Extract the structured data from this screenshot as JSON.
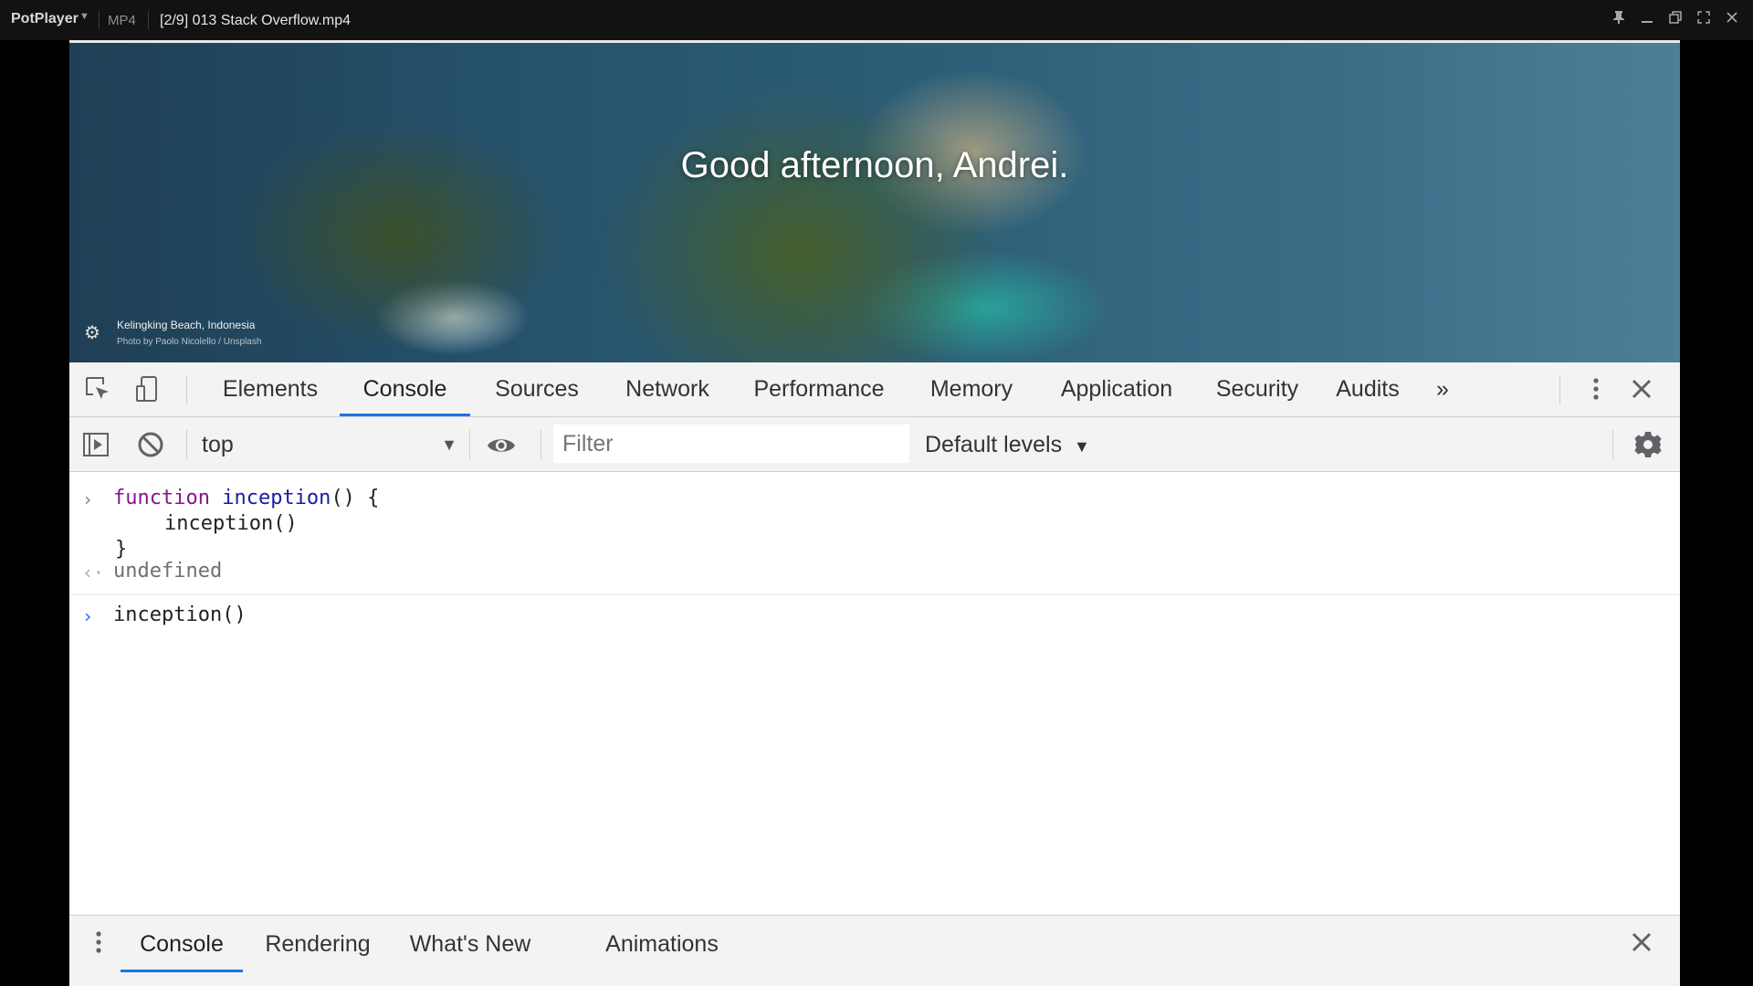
{
  "player": {
    "app_name": "PotPlayer",
    "format": "MP4",
    "file_title": "[2/9] 013 Stack Overflow.mp4",
    "icons": [
      "chevron-down-icon",
      "pin-icon",
      "minimize-icon",
      "restore-icon",
      "fullscreen-icon",
      "close-icon"
    ]
  },
  "hero": {
    "greeting": "Good afternoon, Andrei.",
    "location": "Kelingking Beach, Indonesia",
    "credit": "Photo by Paolo Nicolello / Unsplash"
  },
  "devtools": {
    "tabs": [
      {
        "label": "Elements"
      },
      {
        "label": "Console"
      },
      {
        "label": "Sources"
      },
      {
        "label": "Network"
      },
      {
        "label": "Performance"
      },
      {
        "label": "Memory"
      },
      {
        "label": "Application"
      },
      {
        "label": "Security"
      },
      {
        "label": "Audits"
      }
    ],
    "active_tab": "Console",
    "more_tabs_glyph": "»",
    "console_toolbar": {
      "context": "top",
      "filter_placeholder": "Filter",
      "levels_label": "Default levels",
      "levels_arrow": "▼"
    },
    "console": {
      "input1": {
        "keyword": "function",
        "name": "inception",
        "rest": "() {",
        "body": "inception()",
        "close": "}"
      },
      "result1": "undefined",
      "input2": "inception()"
    },
    "drawer": {
      "tabs": [
        {
          "label": "Console"
        },
        {
          "label": "Rendering"
        },
        {
          "label": "What's New"
        },
        {
          "label": "Animations"
        }
      ],
      "active_tab": "Console"
    }
  },
  "colors": {
    "accent": "#1a73e8",
    "keyword": "#881391",
    "function_name": "#1a1aa6"
  }
}
